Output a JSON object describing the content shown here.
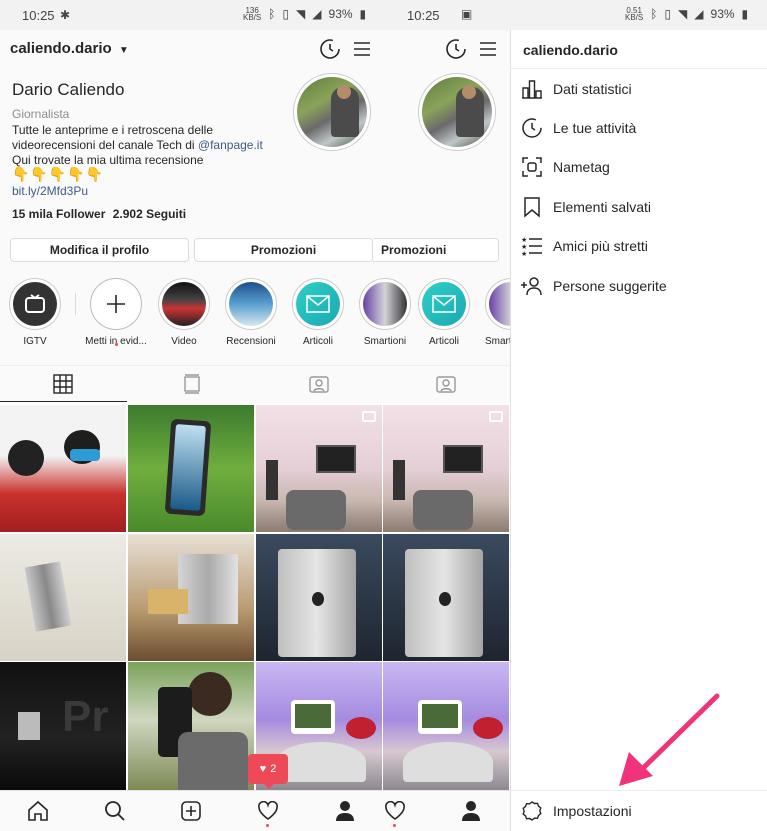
{
  "status_left": {
    "time": "10:25",
    "speed": "136\nKB/S",
    "battery": "93%"
  },
  "status_right": {
    "time": "10:25",
    "speed": "0.51\nKB/S",
    "battery": "93%"
  },
  "profile": {
    "username": "caliendo.dario",
    "name": "Dario Caliendo",
    "category": "Giornalista",
    "bio_line1": "Tutte le anteprime e i retroscena delle",
    "bio_line2_prefix": "videorecensioni del canale Tech di ",
    "bio_mention": "@fanpage.it",
    "bio_line3": "Qui trovate la mia ultima recensione",
    "bio_emojis": "👇👇👇👇👇",
    "link": "bit.ly/2Mfd3Pu",
    "followers": "15 mila Follower",
    "following": "2.902 Seguiti"
  },
  "buttons": {
    "edit_profile": "Modifica il profilo",
    "promotions": "Promozioni",
    "promotions_dup": "Promozioni"
  },
  "highlights": [
    {
      "label": "IGTV"
    },
    {
      "label": "Metti in evid..."
    },
    {
      "label": "Video"
    },
    {
      "label": "Recensioni"
    },
    {
      "label": "Articoli"
    },
    {
      "label": "Smartioni"
    },
    {
      "label": "Articoli"
    },
    {
      "label": "Smart"
    }
  ],
  "notification": {
    "count": "2"
  },
  "drawer": {
    "title": "caliendo.dario",
    "items": [
      {
        "label": "Dati statistici",
        "icon": "bar-chart-icon"
      },
      {
        "label": "Le tue attività",
        "icon": "activity-icon"
      },
      {
        "label": "Nametag",
        "icon": "nametag-icon"
      },
      {
        "label": "Elementi salvati",
        "icon": "bookmark-icon"
      },
      {
        "label": "Amici più stretti",
        "icon": "close-friends-icon"
      },
      {
        "label": "Persone suggerite",
        "icon": "add-person-icon"
      }
    ],
    "settings": "Impostazioni"
  },
  "colors": {
    "accent": "#ed4956",
    "link": "#3d5a87",
    "arrow": "#f0337a"
  }
}
